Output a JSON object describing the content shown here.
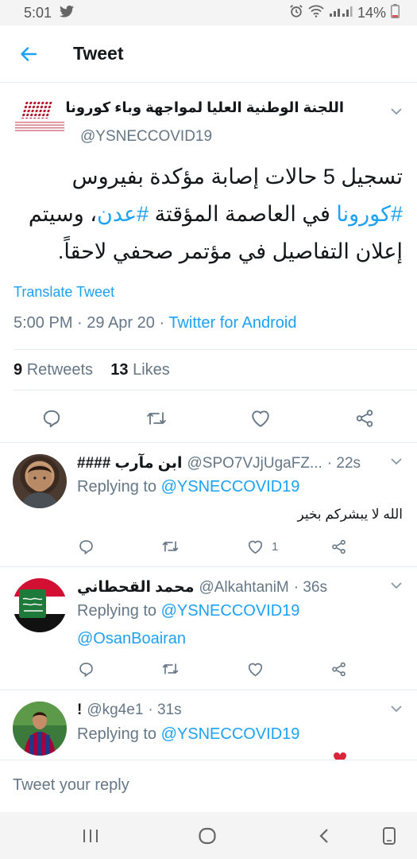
{
  "status_bar": {
    "time": "5:01",
    "battery": "14%"
  },
  "header": {
    "title": "Tweet"
  },
  "tweet": {
    "author_name": "اللجنة الوطنية العليا لمواجهة وباء كورونا",
    "handle": "@YSNECCOVID19",
    "text_line1": "تسجيل 5 حالات إصابة مؤكدة بفيروس",
    "hashtag_corona": "#كورونا",
    "text_line2_mid": " في العاصمة المؤقتة ",
    "hashtag_aden": "#عدن",
    "text_line2_end": "، وسيتم",
    "text_line3": "إعلان التفاصيل في مؤتمر صحفي لاحقاً.",
    "translate_label": "Translate Tweet",
    "time": "5:00 PM",
    "date": "29 Apr 20",
    "source": "Twitter for Android",
    "retweets_count": "9",
    "retweets_label": "Retweets",
    "likes_count": "13",
    "likes_label": "Likes"
  },
  "replies": [
    {
      "name": "ابن مآرب ####",
      "handle": "@SPO7VJjUgaFZ...",
      "time": "· 22s",
      "replying_label": "Replying to",
      "replying_to": "@YSNECCOVID19",
      "text": "الله لا يبشركم بخير",
      "like_count": "1"
    },
    {
      "name": "محمد القحطاني",
      "handle": "@AlkahtaniM",
      "time": "· 36s",
      "replying_label": "Replying to",
      "replying_to": "@YSNECCOVID19",
      "mention": "@OsanBoairan"
    },
    {
      "name": "!",
      "handle": "@kg4e1",
      "time": "· 31s",
      "replying_label": "Replying to",
      "replying_to": "@YSNECCOVID19"
    }
  ],
  "compose": {
    "placeholder": "Tweet your reply"
  },
  "colors": {
    "accent": "#1da1f2",
    "secondary_text": "#657786",
    "divider": "#e6ecf0"
  }
}
